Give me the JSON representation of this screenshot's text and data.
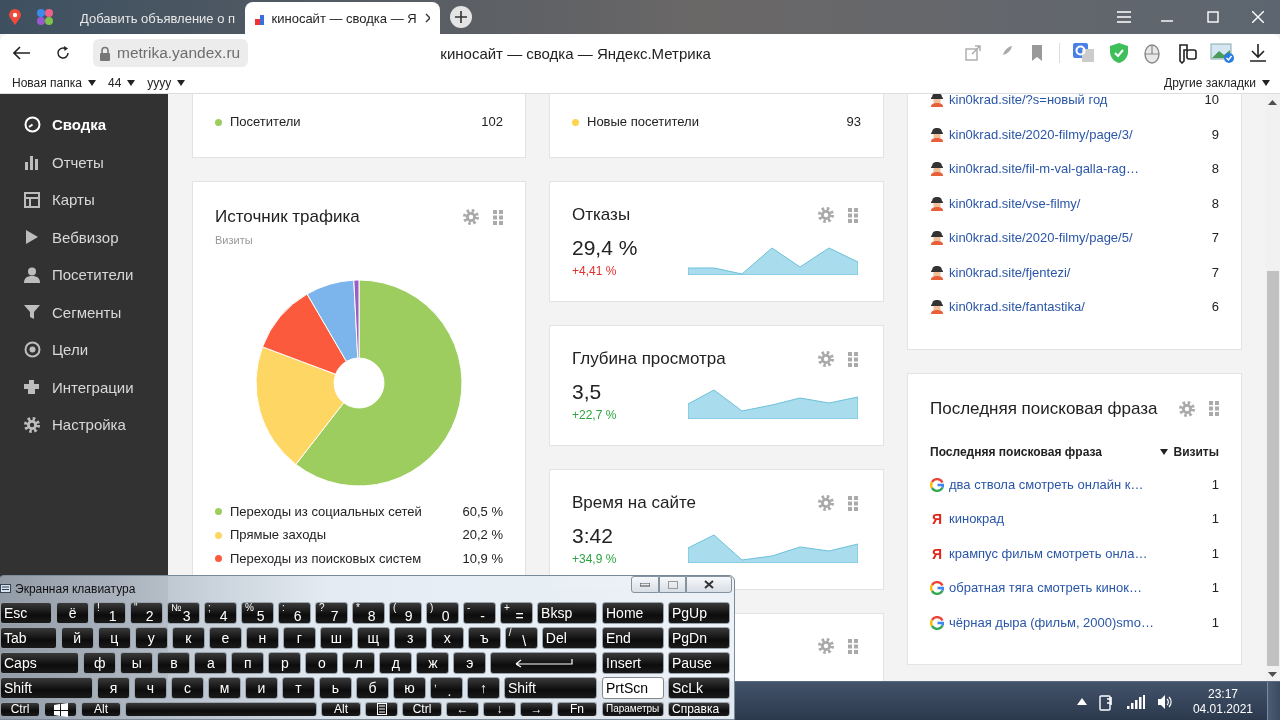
{
  "browser": {
    "tabs": [
      {
        "title": "Добавить объявление о п",
        "selected": false
      },
      {
        "title": "киносайт — сводка — Я",
        "selected": true
      }
    ],
    "url": "metrika.yandex.ru",
    "page_title": "киносайт — сводка — Яндекс.Метрика",
    "bookmarks": [
      "Новая папка",
      "44",
      "yyyy"
    ],
    "other_bookmarks": "Другие закладки"
  },
  "sidebar": {
    "items": [
      {
        "label": "Сводка",
        "selected": true
      },
      {
        "label": "Отчеты",
        "selected": false
      },
      {
        "label": "Карты",
        "selected": false
      },
      {
        "label": "Вебвизор",
        "selected": false
      },
      {
        "label": "Посетители",
        "selected": false
      },
      {
        "label": "Сегменты",
        "selected": false
      },
      {
        "label": "Цели",
        "selected": false
      },
      {
        "label": "Интеграции",
        "selected": false
      },
      {
        "label": "Настройка",
        "selected": false
      }
    ]
  },
  "top_cards": [
    {
      "label": "Посетители",
      "value": "102",
      "color": "#9ccd5e"
    },
    {
      "label": "Новые посетители",
      "value": "93",
      "color": "#fdd44f"
    }
  ],
  "traffic": {
    "title": "Источник трафика",
    "subtitle": "Визиты",
    "chart_data": {
      "type": "donut",
      "values": [
        60.5,
        20.2,
        10.9,
        7.6,
        0.8
      ],
      "colors": [
        "#9ccd5e",
        "#fdd663",
        "#fb5b3c",
        "#7cb5ec",
        "#9a5cc6"
      ]
    },
    "legend": [
      {
        "label": "Переходы из социальных сетей",
        "value": "60,5 %",
        "color": "#9ccd5e"
      },
      {
        "label": "Прямые заходы",
        "value": "20,2 %",
        "color": "#fdd663"
      },
      {
        "label": "Переходы из поисковых систем",
        "value": "10,9 %",
        "color": "#fb5b3c"
      }
    ]
  },
  "metrics": [
    {
      "title": "Отказы",
      "value": "29,4 %",
      "change": "+4,41 %",
      "negative": true
    },
    {
      "title": "Глубина просмотра",
      "value": "3,5",
      "change": "+22,7 %",
      "negative": false
    },
    {
      "title": "Время на сайте",
      "value": "3:42",
      "change": "+34,9 %",
      "negative": false
    }
  ],
  "pages": [
    {
      "url": "kin0krad.site/?s=новый год",
      "visits": "10"
    },
    {
      "url": "kin0krad.site/2020-filmy/page/3/",
      "visits": "9"
    },
    {
      "url": "kin0krad.site/fil-m-val-galla-rag…",
      "visits": "8"
    },
    {
      "url": "kin0krad.site/vse-filmy/",
      "visits": "8"
    },
    {
      "url": "kin0krad.site/2020-filmy/page/5/",
      "visits": "7"
    },
    {
      "url": "kin0krad.site/fjentezi/",
      "visits": "7"
    },
    {
      "url": "kin0krad.site/fantastika/",
      "visits": "6"
    }
  ],
  "search_phrases": {
    "title": "Последняя поисковая фраза",
    "columns": [
      "Последняя поисковая фраза",
      "Визиты"
    ],
    "rows": [
      {
        "kind": "ring",
        "phrase": "два ствола смотреть онлайн к…",
        "visits": "1"
      },
      {
        "kind": "letter",
        "mark": "Я",
        "phrase": "кинокрад",
        "visits": "1"
      },
      {
        "kind": "letter",
        "mark": "Я",
        "phrase": "крампус фильм смотреть онла…",
        "visits": "1"
      },
      {
        "kind": "ring",
        "phrase": "обратная тяга смотреть кинок…",
        "visits": "1"
      },
      {
        "kind": "ring",
        "phrase": "чёрная дыра (фильм, 2000)smo…",
        "visits": "1"
      }
    ]
  },
  "keyboard": {
    "title": "Экранная клавиатура",
    "rows": [
      {
        "keys": [
          {
            "label": "Esc",
            "kind": "wide"
          },
          {
            "label": "ё",
            "kind": "char"
          },
          {
            "label": "1",
            "shift": "!",
            "kind": "char"
          },
          {
            "label": "2",
            "shift": "\"",
            "kind": "char"
          },
          {
            "label": "3",
            "shift": "№",
            "kind": "char"
          },
          {
            "label": "4",
            "shift": ";",
            "kind": "char"
          },
          {
            "label": "5",
            "shift": "%",
            "kind": "char"
          },
          {
            "label": "6",
            "shift": ":",
            "kind": "char"
          },
          {
            "label": "7",
            "shift": "?",
            "kind": "char"
          },
          {
            "label": "8",
            "shift": "*",
            "kind": "char"
          },
          {
            "label": "9",
            "shift": "(",
            "kind": "char"
          },
          {
            "label": "0",
            "shift": ")",
            "kind": "char"
          },
          {
            "label": "-",
            "shift": "-",
            "kind": "char"
          },
          {
            "label": "=",
            "shift": "+",
            "kind": "char"
          },
          {
            "label": "Bksp",
            "kind": "wide"
          }
        ]
      },
      {
        "keys": [
          {
            "label": "Tab",
            "kind": "wide"
          },
          {
            "label": "й",
            "kind": "char"
          },
          {
            "label": "ц",
            "kind": "char"
          },
          {
            "label": "у",
            "kind": "char"
          },
          {
            "label": "к",
            "kind": "char"
          },
          {
            "label": "е",
            "kind": "char"
          },
          {
            "label": "н",
            "kind": "char"
          },
          {
            "label": "г",
            "kind": "char"
          },
          {
            "label": "ш",
            "kind": "char"
          },
          {
            "label": "щ",
            "kind": "char"
          },
          {
            "label": "з",
            "kind": "char"
          },
          {
            "label": "х",
            "kind": "char"
          },
          {
            "label": "ъ",
            "kind": "char"
          },
          {
            "label": "\\",
            "shift": "/",
            "kind": "char"
          },
          {
            "label": "Del",
            "kind": "wide"
          }
        ]
      },
      {
        "keys": [
          {
            "label": "Caps",
            "kind": "wide"
          },
          {
            "label": "ф",
            "kind": "char"
          },
          {
            "label": "ы",
            "kind": "char"
          },
          {
            "label": "в",
            "kind": "char"
          },
          {
            "label": "а",
            "kind": "char"
          },
          {
            "label": "п",
            "kind": "char"
          },
          {
            "label": "р",
            "kind": "char"
          },
          {
            "label": "о",
            "kind": "char"
          },
          {
            "label": "л",
            "kind": "char"
          },
          {
            "label": "д",
            "kind": "char"
          },
          {
            "label": "ж",
            "kind": "char"
          },
          {
            "label": "э",
            "kind": "char"
          },
          {
            "kind": "enter"
          }
        ]
      },
      {
        "keys": [
          {
            "label": "Shift",
            "kind": "wide"
          },
          {
            "label": "я",
            "kind": "char"
          },
          {
            "label": "ч",
            "kind": "char"
          },
          {
            "label": "с",
            "kind": "char"
          },
          {
            "label": "м",
            "kind": "char"
          },
          {
            "label": "и",
            "kind": "char"
          },
          {
            "label": "т",
            "kind": "char"
          },
          {
            "label": "ь",
            "kind": "char"
          },
          {
            "label": "б",
            "kind": "char"
          },
          {
            "label": "ю",
            "kind": "char"
          },
          {
            "label": ".",
            "shift": ",",
            "kind": "char"
          },
          {
            "label": "↑",
            "kind": "char"
          },
          {
            "label": "Shift",
            "kind": "wide"
          }
        ]
      },
      {
        "keys": [
          {
            "label": "Ctrl",
            "kind": "mod"
          },
          {
            "kind": "win"
          },
          {
            "label": "Alt",
            "kind": "mod"
          },
          {
            "kind": "space"
          },
          {
            "label": "Alt",
            "kind": "mod"
          },
          {
            "kind": "menu"
          },
          {
            "label": "Ctrl",
            "kind": "mod"
          },
          {
            "label": "←",
            "kind": "char"
          },
          {
            "label": "↓",
            "kind": "char"
          },
          {
            "label": "→",
            "kind": "char"
          },
          {
            "label": "Fn",
            "kind": "mod"
          }
        ]
      }
    ],
    "nav_keys": [
      {
        "label": "Home",
        "kind": "key",
        "on": false
      },
      {
        "label": "PgUp",
        "kind": "key",
        "on": false
      },
      {
        "label": "End",
        "kind": "key",
        "on": false
      },
      {
        "label": "PgDn",
        "kind": "key",
        "on": false
      },
      {
        "label": "Insert",
        "kind": "key",
        "on": false
      },
      {
        "label": "Pause",
        "kind": "key",
        "on": false
      },
      {
        "label": "PrtScn",
        "kind": "key",
        "on": true
      },
      {
        "label": "ScLk",
        "kind": "key",
        "on": false
      },
      {
        "label": "Параметры",
        "kind": "small",
        "on": false
      },
      {
        "label": "Справка",
        "kind": "key",
        "on": false
      }
    ]
  },
  "taskbar": {
    "time": "23:17",
    "date": "04.01.2021"
  }
}
